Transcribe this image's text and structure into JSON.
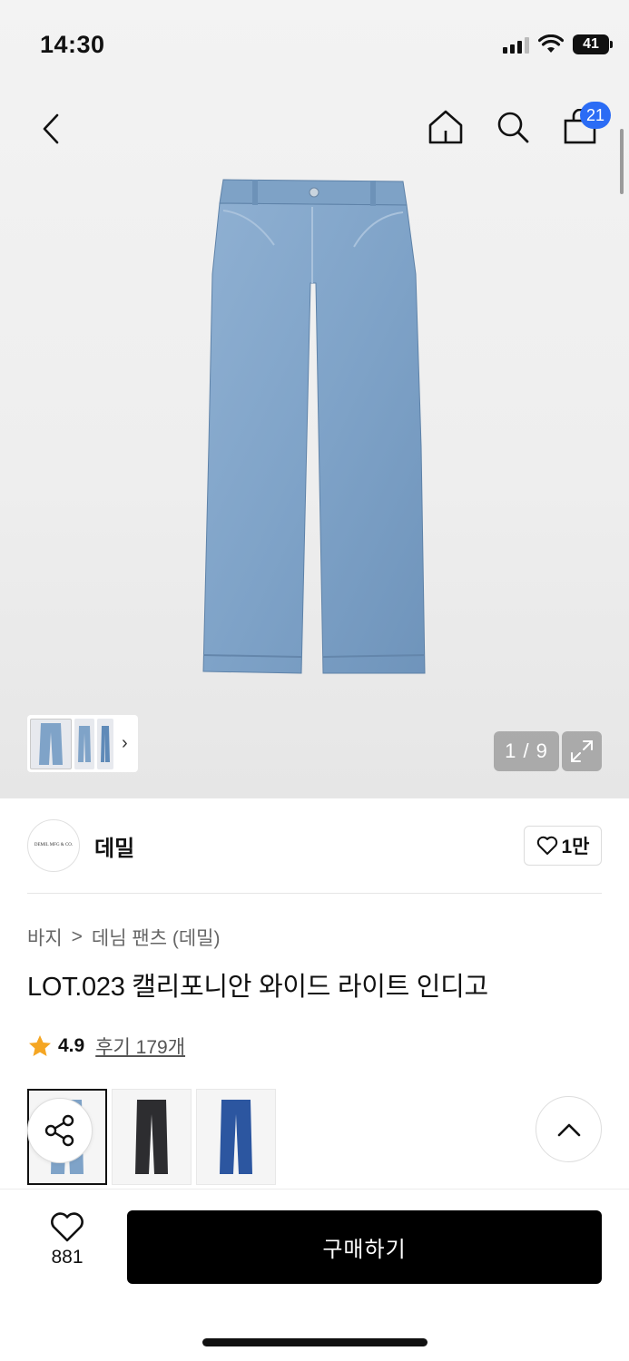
{
  "status_bar": {
    "time": "14:30",
    "battery": "41"
  },
  "nav": {
    "cart_count": "21"
  },
  "gallery": {
    "counter": "1 / 9"
  },
  "brand": {
    "logo_text": "DEMIL MFG & CO.",
    "name": "데밀",
    "likes": "1만"
  },
  "breadcrumb": {
    "category": "바지",
    "separator": ">",
    "subcategory": "데님 팬츠 (데밀)"
  },
  "product": {
    "title": "LOT.023 캘리포니안 와이드 라이트 인디고"
  },
  "rating": {
    "score": "4.9",
    "reviews": "후기 179개"
  },
  "colors": {
    "accent_badge": "#2b6cf5",
    "rating_star": "#f5a623",
    "light_indigo": "#7fa3c8",
    "black_denim": "#2d2d30",
    "dark_indigo": "#2c56a0"
  },
  "bottom_bar": {
    "wish_count": "881",
    "buy_label": "구매하기"
  }
}
